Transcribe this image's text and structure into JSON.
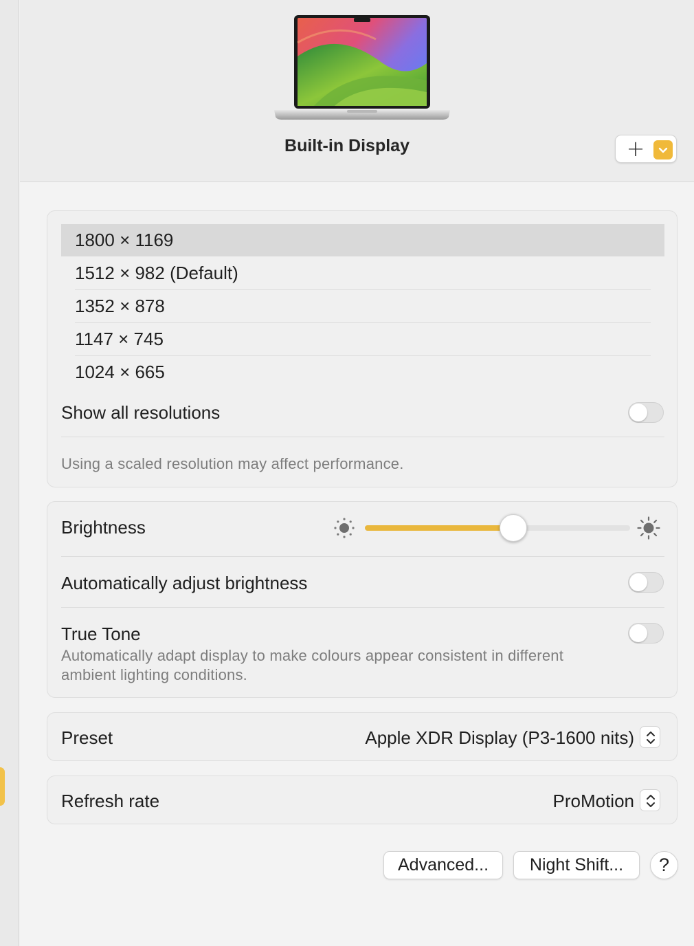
{
  "header": {
    "display_title": "Built-in Display",
    "add_label": "+",
    "accent_color": "#f0b93a"
  },
  "resolutions": {
    "items": [
      {
        "label": "1800 × 1169",
        "selected": true
      },
      {
        "label": "1512 × 982 (Default)",
        "selected": false
      },
      {
        "label": "1352 × 878",
        "selected": false
      },
      {
        "label": "1147 × 745",
        "selected": false
      },
      {
        "label": "1024 × 665",
        "selected": false
      }
    ],
    "show_all_label": "Show all resolutions",
    "show_all_on": false,
    "note": "Using a scaled resolution may affect performance."
  },
  "brightness": {
    "label": "Brightness",
    "level": 0.56,
    "auto_label": "Automatically adjust brightness",
    "auto_on": false,
    "true_tone_label": "True Tone",
    "true_tone_on": false,
    "true_tone_desc_line1": "Automatically adapt display to make colours appear consistent in different",
    "true_tone_desc_line2": "ambient lighting conditions."
  },
  "preset": {
    "label": "Preset",
    "value": "Apple XDR Display (P3-1600 nits)"
  },
  "refresh": {
    "label": "Refresh rate",
    "value": "ProMotion"
  },
  "footer": {
    "advanced_label": "Advanced...",
    "night_shift_label": "Night Shift...",
    "help_label": "?"
  },
  "icons": {
    "brightness_low": "sun-small-icon",
    "brightness_high": "sun-large-icon",
    "add_menu_chevron": "chevron-down-icon",
    "stepper": "up-down-chevron-icon"
  }
}
